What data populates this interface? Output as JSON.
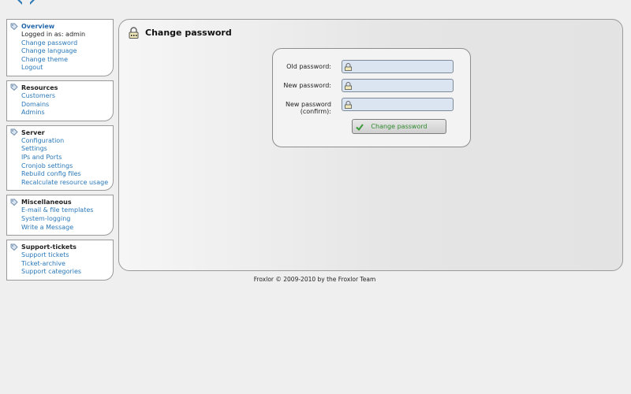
{
  "colors": {
    "background": "#efefef",
    "link": "#2a78b8",
    "active_heading": "#2266aa",
    "input_bg": "#dbe5f1",
    "button_text": "#2f8a2f"
  },
  "sidebar": {
    "sections": [
      {
        "title": "Overview",
        "icon": "tag-icon",
        "items": [
          {
            "label": "Logged in as: admin",
            "static": true
          },
          {
            "label": "Change password"
          },
          {
            "label": "Change language"
          },
          {
            "label": "Change theme"
          },
          {
            "label": "Logout"
          }
        ]
      },
      {
        "title": "Resources",
        "icon": "tag-icon",
        "items": [
          {
            "label": "Customers"
          },
          {
            "label": "Domains"
          },
          {
            "label": "Admins"
          }
        ]
      },
      {
        "title": "Server",
        "icon": "tag-icon",
        "items": [
          {
            "label": "Configuration"
          },
          {
            "label": "Settings"
          },
          {
            "label": "IPs and Ports"
          },
          {
            "label": "Cronjob settings"
          },
          {
            "label": "Rebuild config files"
          },
          {
            "label": "Recalculate resource usage"
          }
        ]
      },
      {
        "title": "Miscellaneous",
        "icon": "tag-icon",
        "items": [
          {
            "label": "E-mail & file templates"
          },
          {
            "label": "System-logging"
          },
          {
            "label": "Write a Message"
          }
        ]
      },
      {
        "title": "Support-tickets",
        "icon": "tag-icon",
        "items": [
          {
            "label": "Support tickets"
          },
          {
            "label": "Ticket-archive"
          },
          {
            "label": "Support categories"
          }
        ]
      }
    ]
  },
  "main": {
    "title": "Change password",
    "title_icon": "lock-icon",
    "form": {
      "old_password_label": "Old password:",
      "new_password_label": "New password:",
      "confirm_label_line1": "New password",
      "confirm_label_line2": "(confirm):",
      "old_password_value": "",
      "new_password_value": "",
      "confirm_password_value": "",
      "input_icon": "lock-icon",
      "submit_label": "Change password",
      "submit_icon": "checkmark-icon"
    }
  },
  "footer": {
    "text": "Froxlor © 2009-2010 by the Froxlor Team"
  }
}
